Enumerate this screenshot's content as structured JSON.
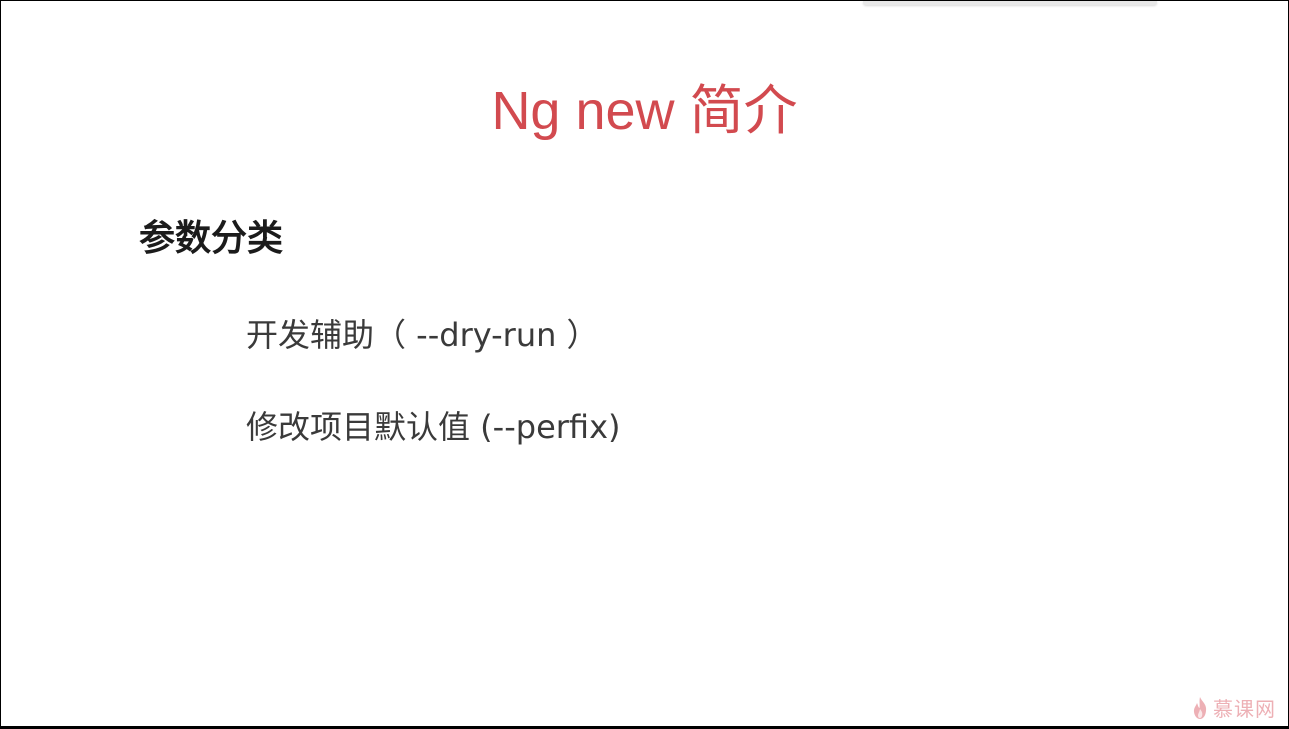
{
  "slide": {
    "title": "Ng new 简介",
    "section_heading": "参数分类",
    "bullets": [
      {
        "text": "开发辅助（ --dry-run ）"
      },
      {
        "text": "修改项目默认值 (--perfix)"
      }
    ]
  },
  "watermark": {
    "text": "慕课网",
    "logo_icon": "flame-logo-icon"
  },
  "colors": {
    "title": "#d24a4f",
    "heading": "#1b1b1b",
    "bullet_text": "#3a3a3a",
    "watermark": "#e0707a",
    "background": "#ffffff",
    "frame": "#000000"
  }
}
